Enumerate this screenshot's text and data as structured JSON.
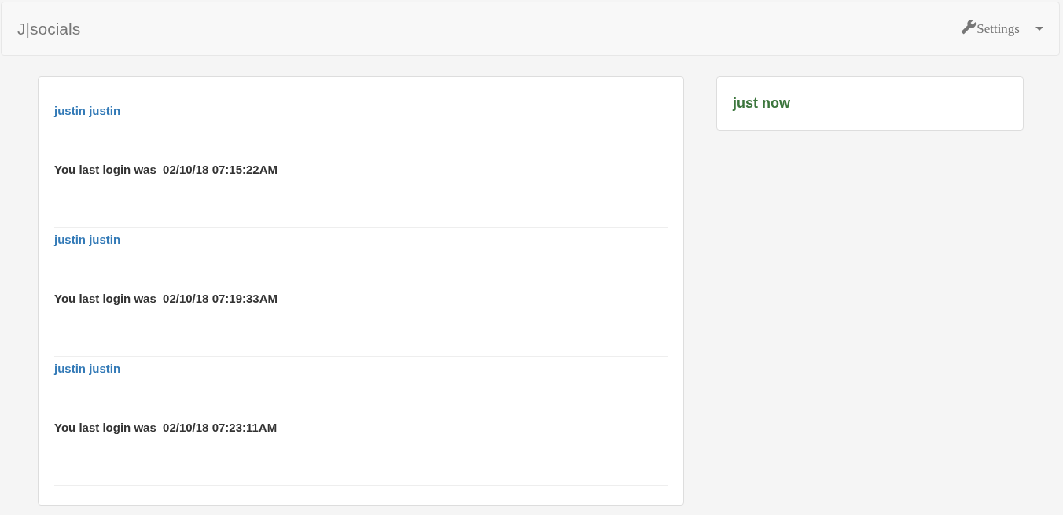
{
  "navbar": {
    "brand": "J|socials",
    "settings": "Settings"
  },
  "logins": [
    {
      "name": "justin justin",
      "text": "You last login was  02/10/18 07:15:22AM"
    },
    {
      "name": "justin justin",
      "text": "You last login was  02/10/18 07:19:33AM"
    },
    {
      "name": "justin justin",
      "text": "You last login was  02/10/18 07:23:11AM"
    }
  ],
  "status": {
    "text": "just now"
  }
}
